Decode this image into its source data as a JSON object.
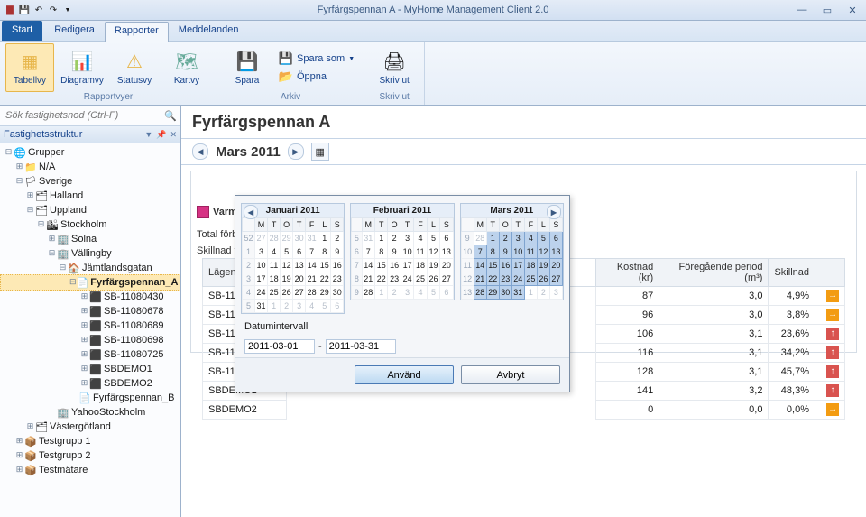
{
  "window": {
    "title": "Fyrfärgspennan A - MyHome Management Client 2.0"
  },
  "tabs": {
    "start": "Start",
    "redigera": "Redigera",
    "rapporter": "Rapporter",
    "meddelanden": "Meddelanden"
  },
  "ribbon": {
    "rapportvyer": {
      "caption": "Rapportvyer",
      "tabellvy": "Tabellvy",
      "diagramvy": "Diagramvy",
      "statusvy": "Statusvy",
      "kartvy": "Kartvy"
    },
    "arkiv": {
      "caption": "Arkiv",
      "spara": "Spara",
      "spara_som": "Spara som",
      "oppna": "Öppna"
    },
    "skriv_ut": {
      "caption": "Skriv ut",
      "skriv_ut": "Skriv ut"
    }
  },
  "search": {
    "placeholder": "Sök fastighetsnod (Ctrl-F)"
  },
  "treeHeader": "Fastighetsstruktur",
  "tree": {
    "grupper": "Grupper",
    "na": "N/A",
    "sverige": "Sverige",
    "halland": "Halland",
    "uppland": "Uppland",
    "stockholm": "Stockholm",
    "solna": "Solna",
    "vallingby": "Vällingby",
    "jamtlandsgatan": "Jämtlandsgatan",
    "fyrf_a": "Fyrfärgspennan_A",
    "sb1": "SB-11080430",
    "sb2": "SB-11080678",
    "sb3": "SB-11080689",
    "sb4": "SB-11080698",
    "sb5": "SB-11080725",
    "sbd1": "SBDEMO1",
    "sbd2": "SBDEMO2",
    "fyrf_b": "Fyrfärgspennan_B",
    "yahoo": "YahooStockholm",
    "vastergotland": "Västergötland",
    "testgrupp1": "Testgrupp 1",
    "testgrupp2": "Testgrupp 2",
    "testmatare": "Testmätare"
  },
  "main": {
    "title": "Fyrfärgspennan A",
    "period": "Mars 2011",
    "section": "Varmvat",
    "row_total": "Total förb",
    "row_skillnad": "Skillnad fr",
    "col_lagenhet": "Lägenhet",
    "col_kostnad": "Kostnad (kr)",
    "col_foreg": "Föregående period (m³)",
    "col_skillnad": "Skillnad",
    "rows": [
      {
        "l": "SB-11080",
        "k": "87",
        "f": "3,0",
        "s": "4,9%",
        "a": "o"
      },
      {
        "l": "SB-11080",
        "k": "96",
        "f": "3,0",
        "s": "3,8%",
        "a": "o"
      },
      {
        "l": "SB-11080",
        "k": "106",
        "f": "3,1",
        "s": "23,6%",
        "a": "r"
      },
      {
        "l": "SB-11080",
        "k": "116",
        "f": "3,1",
        "s": "34,2%",
        "a": "r"
      },
      {
        "l": "SB-11080",
        "k": "128",
        "f": "3,1",
        "s": "45,7%",
        "a": "r"
      },
      {
        "l": "SBDEMO1",
        "k": "141",
        "f": "3,2",
        "s": "48,3%",
        "a": "r"
      },
      {
        "l": "SBDEMO2",
        "k": "0",
        "f": "0,0",
        "s": "0,0%",
        "a": "o"
      }
    ]
  },
  "popup": {
    "months": [
      {
        "name": "Januari 2011",
        "wk0": 52,
        "lead": 5,
        "days": 31,
        "trail": 6,
        "nav": "l",
        "hl": []
      },
      {
        "name": "Februari 2011",
        "wk0": 5,
        "lead": 1,
        "days": 28,
        "trail": 6,
        "nav": "",
        "hl": []
      },
      {
        "name": "Mars 2011",
        "wk0": 9,
        "lead": 1,
        "days": 31,
        "trail": 3,
        "nav": "r",
        "hl": "all"
      }
    ],
    "dow": [
      "M",
      "T",
      "O",
      "T",
      "F",
      "L",
      "S"
    ],
    "di_label": "Datumintervall",
    "from": "2011-03-01",
    "to": "2011-03-31",
    "anvand": "Använd",
    "avbryt": "Avbryt"
  }
}
